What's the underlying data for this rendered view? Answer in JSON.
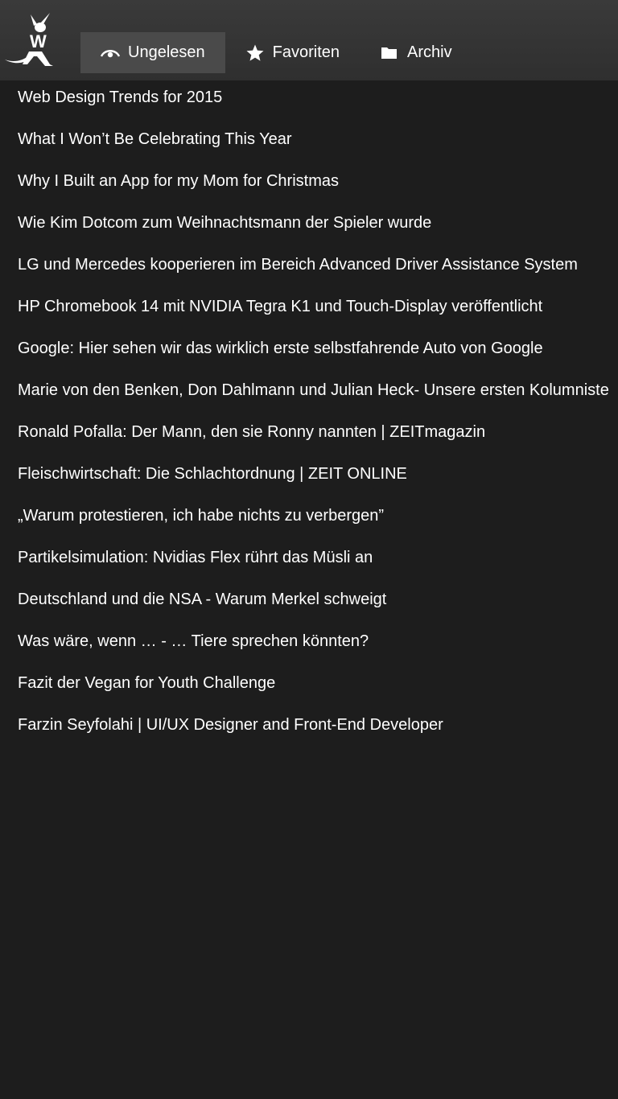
{
  "colors": {
    "background": "#1d1d1d",
    "header": "#333333",
    "active_tab": "#4a4a4a",
    "text": "#ffffff"
  },
  "header": {
    "logo_icon": "wallabag-kangaroo-logo",
    "tabs": [
      {
        "label": "Ungelesen",
        "icon": "eye-icon",
        "active": true
      },
      {
        "label": "Favoriten",
        "icon": "star-icon",
        "active": false
      },
      {
        "label": "Archiv",
        "icon": "folder-icon",
        "active": false
      }
    ]
  },
  "articles": [
    "Web Design Trends for 2015",
    "What I Won’t Be Celebrating This Year",
    "Why I Built an App for my Mom for Christmas",
    "Wie Kim Dotcom zum Weihnachtsmann der Spieler wurde",
    "LG und Mercedes kooperieren im Bereich Advanced Driver Assistance System",
    "HP Chromebook 14 mit NVIDIA Tegra K1 und Touch-Display veröffentlicht",
    "Google: Hier sehen wir das wirklich erste selbstfahrende Auto von Google",
    "Marie von den Benken, Don Dahlmann und Julian Heck- Unsere ersten Kolumniste",
    "Ronald Pofalla: Der Mann, den sie Ronny nannten | ZEITmagazin",
    "Fleischwirtschaft: Die Schlachtordnung | ZEIT ONLINE",
    "„Warum protestieren, ich habe nichts zu verbergen”",
    "Partikelsimulation: Nvidias Flex rührt das Müsli an",
    "Deutschland und die NSA - Warum Merkel schweigt",
    "Was wäre, wenn … - … Tiere sprechen könnten?",
    "Fazit der Vegan for Youth Challenge",
    "Farzin Seyfolahi | UI/UX Designer and Front-End Developer"
  ]
}
